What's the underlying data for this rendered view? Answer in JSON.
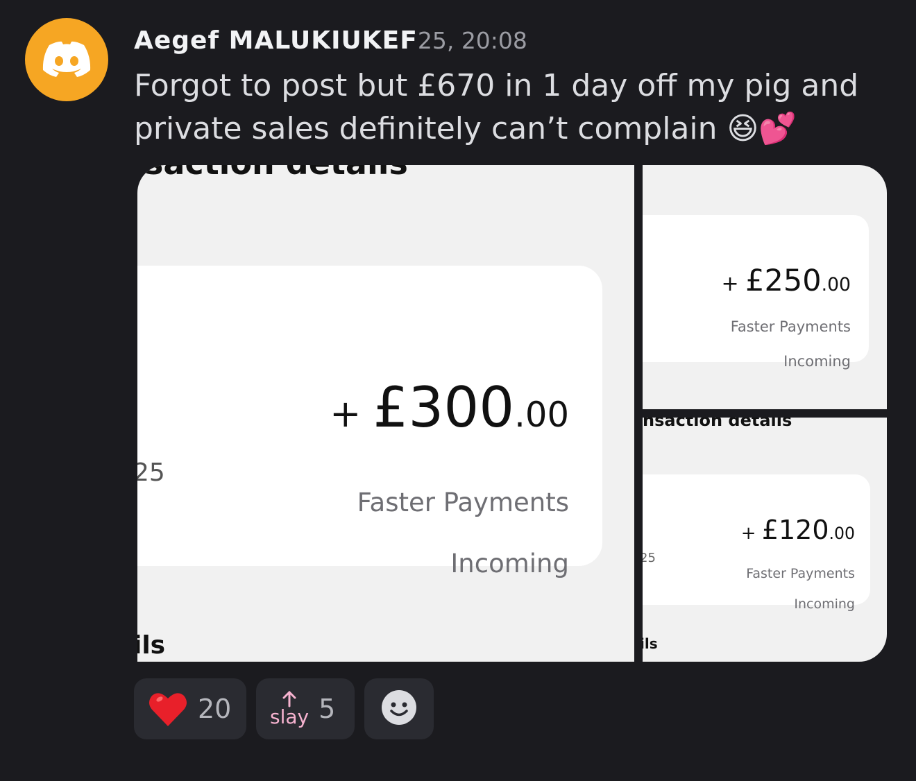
{
  "message": {
    "username": "Aegef MALUKIUKEF",
    "timestamp": "25, 20:08",
    "text": "Forgot to post but £670 in 1 day off my pig and private sales definitely can’t complain",
    "emojis": "😆💕"
  },
  "attachments": {
    "main": {
      "header_fragment": "saction details",
      "amount_prefix": "+ ",
      "amount_whole": "£300",
      "amount_cents": ".00",
      "method": "Faster Payments",
      "direction": "Incoming",
      "left_fragment": "25",
      "footer_fragment": "ils"
    },
    "top": {
      "amount_prefix": "+ ",
      "amount_whole": "£250",
      "amount_cents": ".00",
      "method": "Faster Payments",
      "direction": "Incoming"
    },
    "bottom": {
      "header_fragment": "nsaction details",
      "amount_prefix": "+ ",
      "amount_whole": "£120",
      "amount_cents": ".00",
      "method": "Faster Payments",
      "direction": "Incoming",
      "left_fragment": "25",
      "footer_fragment": "ils"
    }
  },
  "reactions": [
    {
      "icon": "heart-icon",
      "emoji": "❤️",
      "count": "20"
    },
    {
      "icon": "slay-icon",
      "label": "slay",
      "count": "5"
    }
  ],
  "add_reaction_icon": "smiley-icon",
  "colors": {
    "avatar": "#f6a623",
    "background": "#1b1b1f",
    "slay": "#f7b3d0"
  }
}
